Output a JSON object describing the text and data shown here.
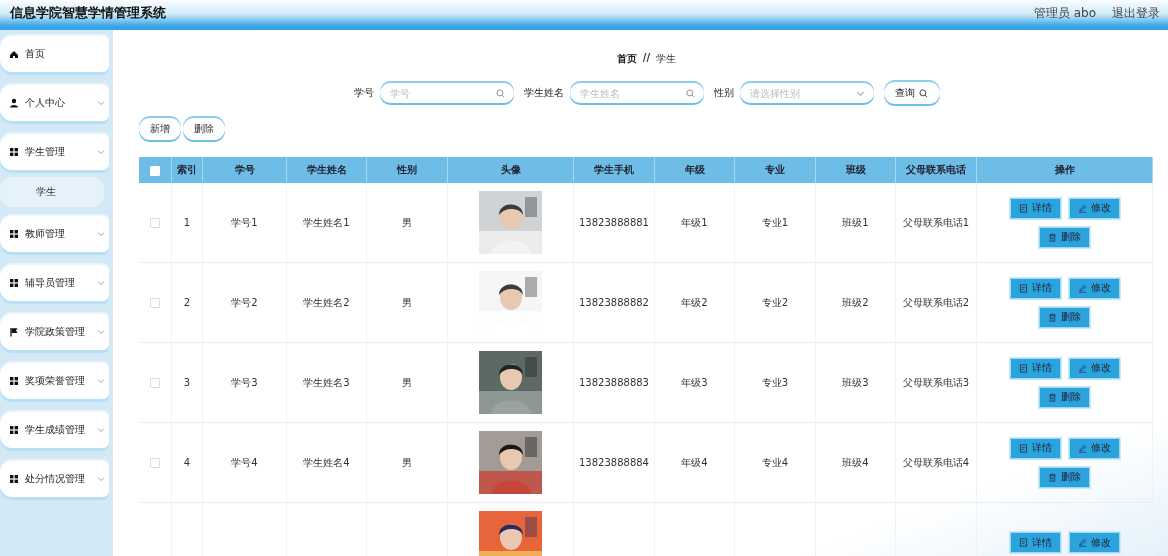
{
  "header": {
    "title": "信息学院智慧学情管理系统",
    "user": "管理员 abo",
    "logout": "退出登录"
  },
  "sidebar": {
    "items": [
      {
        "label": "首页",
        "kind": "home"
      },
      {
        "label": "个人中心",
        "kind": "person"
      },
      {
        "label": "学生管理",
        "kind": "grid",
        "children": [
          {
            "label": "学生",
            "selected": true
          }
        ]
      },
      {
        "label": "教师管理",
        "kind": "grid"
      },
      {
        "label": "辅导员管理",
        "kind": "grid"
      },
      {
        "label": "学院政策管理",
        "kind": "flag"
      },
      {
        "label": "奖项荣誉管理",
        "kind": "grid"
      },
      {
        "label": "学生成绩管理",
        "kind": "grid"
      },
      {
        "label": "处分情况管理",
        "kind": "grid"
      }
    ]
  },
  "breadcrumb": [
    "首页",
    "//",
    "学生"
  ],
  "search": {
    "fields": [
      {
        "label": "学号",
        "placeholder": "学号",
        "kind": "text"
      },
      {
        "label": "学生姓名",
        "placeholder": "学生姓名",
        "kind": "text"
      },
      {
        "label": "性别",
        "placeholder": "请选择性别",
        "kind": "select"
      }
    ],
    "button": "查询"
  },
  "toolbar": [
    "新增",
    "删除"
  ],
  "table": {
    "select_all_checked": false,
    "columns": [
      "索引",
      "学号",
      "学生姓名",
      "性别",
      "头像",
      "学生手机",
      "年级",
      "专业",
      "班级",
      "父母联系电话",
      "操作"
    ],
    "rows": [
      {
        "checked": false,
        "cells": [
          "1",
          "学号1",
          "学生姓名1",
          "男",
          {
            "kind": "picture"
          },
          "13823888881",
          "年级1",
          "专业1",
          "班级1",
          "父母联系电话1"
        ],
        "actions": [
          "详情",
          "修改",
          "删除"
        ]
      },
      {
        "checked": false,
        "cells": [
          "2",
          "学号2",
          "学生姓名2",
          "男",
          {
            "kind": "picture"
          },
          "13823888882",
          "年级2",
          "专业2",
          "班级2",
          "父母联系电话2"
        ],
        "actions": [
          "详情",
          "修改",
          "删除"
        ]
      },
      {
        "checked": false,
        "cells": [
          "3",
          "学号3",
          "学生姓名3",
          "男",
          {
            "kind": "picture"
          },
          "13823888883",
          "年级3",
          "专业3",
          "班级3",
          "父母联系电话3"
        ],
        "actions": [
          "详情",
          "修改",
          "删除"
        ]
      },
      {
        "checked": false,
        "cells": [
          "4",
          "学号4",
          "学生姓名4",
          "男",
          {
            "kind": "picture"
          },
          "13823888884",
          "年级4",
          "专业4",
          "班级4",
          "父母联系电话4"
        ],
        "actions": [
          "详情",
          "修改",
          "删除"
        ]
      },
      {
        "cells": [
          "",
          "",
          "",
          "",
          {
            "kind": "picture"
          },
          "",
          "",
          "",
          "",
          ""
        ],
        "actions": [
          "详情",
          "修改"
        ]
      }
    ]
  }
}
